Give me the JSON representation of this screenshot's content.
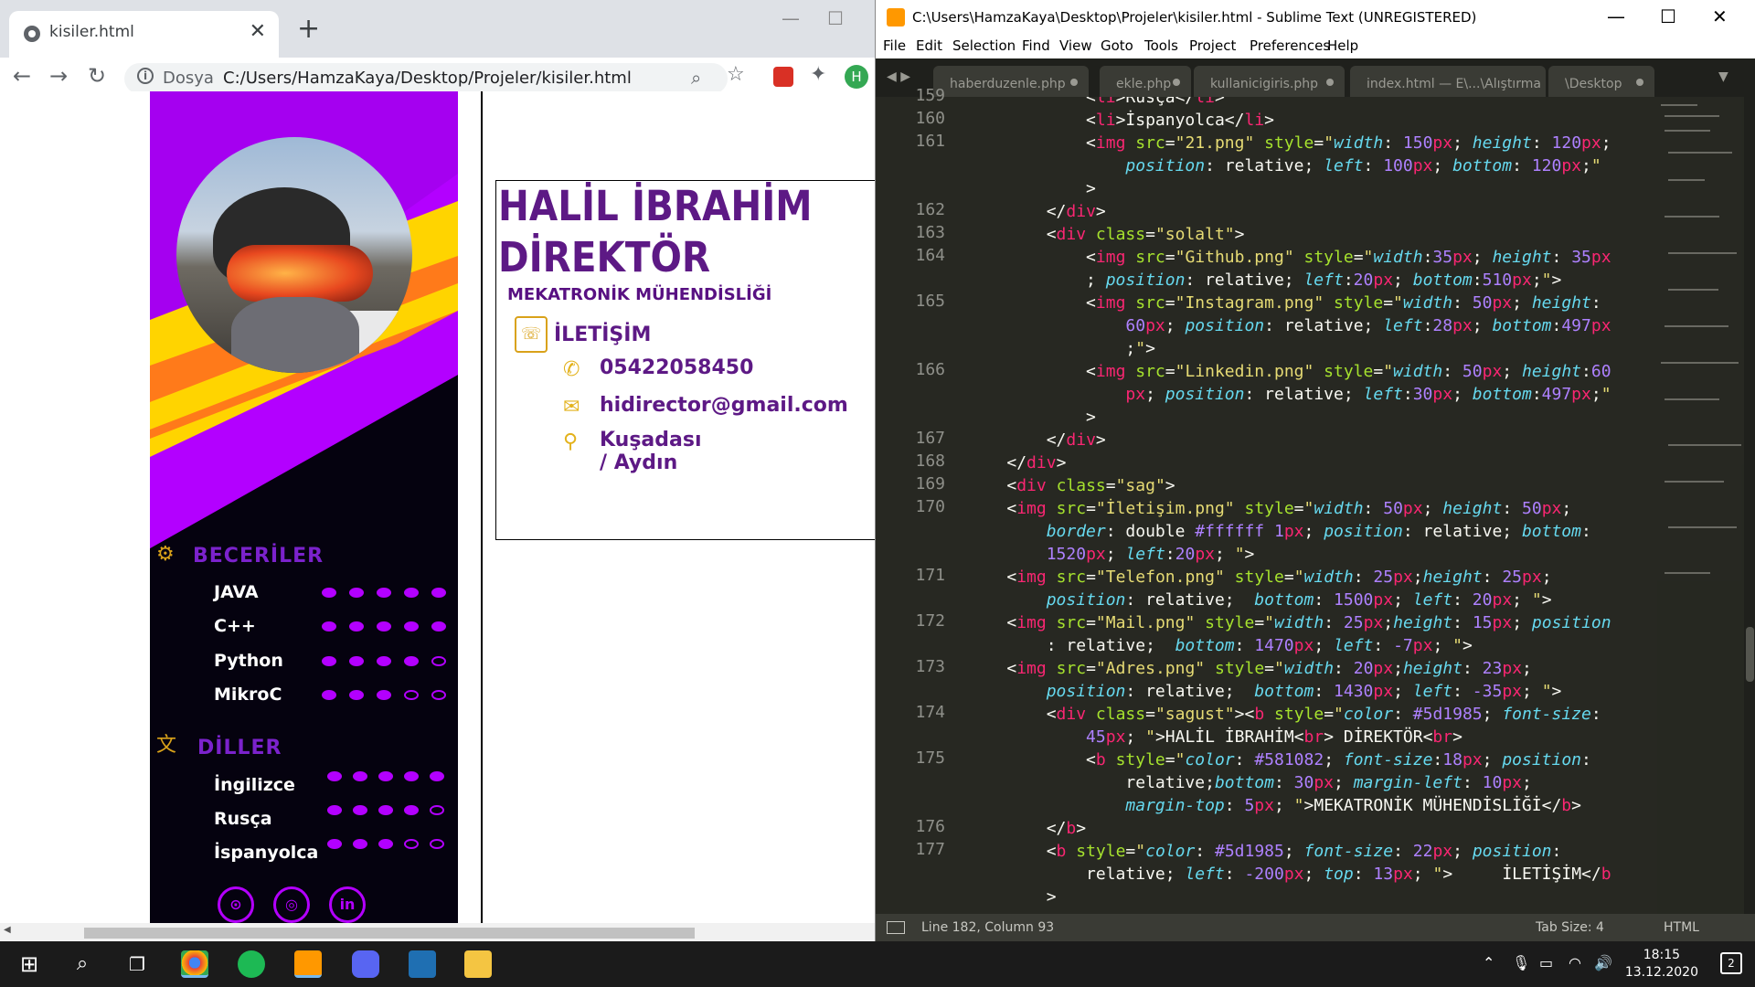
{
  "chrome": {
    "tab_title": "kisiler.html",
    "close_tab": "✕",
    "new_tab": "+",
    "scheme": "Dosya",
    "url": "C:/Users/HamzaKaya/Desktop/Projeler/kisiler.html",
    "profile_initial": "H",
    "minimize": "—",
    "maximize": "☐"
  },
  "cv": {
    "name_line1": "HALİL İBRAHİM",
    "name_line2": "DİREKTÖR",
    "title": "MEKATRONİK MÜHENDİSLİĞİ",
    "contact_title": "İLETİŞİM",
    "phone": "05422058450",
    "email": "hidirector@gmail.com",
    "address": "Kuşadası / Aydın",
    "skills_title": "BECERİLER",
    "skills": [
      {
        "name": "JAVA",
        "level": 5
      },
      {
        "name": "C++",
        "level": 5
      },
      {
        "name": "Python",
        "level": 4
      },
      {
        "name": "MikroC",
        "level": 3
      }
    ],
    "languages_title": "DİLLER",
    "languages": [
      {
        "name": "İngilizce",
        "level": 5
      },
      {
        "name": "Rusça",
        "level": 4
      },
      {
        "name": "İspanyolca",
        "level": 3
      }
    ],
    "social": [
      "github-icon",
      "instagram-icon",
      "linkedin-icon"
    ],
    "colors": {
      "purple": "#5d1985",
      "violet": "#b300ff",
      "yellow": "#ffd400"
    }
  },
  "sublime": {
    "window_title": "C:\\Users\\HamzaKaya\\Desktop\\Projeler\\kisiler.html - Sublime Text (UNREGISTERED)",
    "menu": [
      "File",
      "Edit",
      "Selection",
      "Find",
      "View",
      "Goto",
      "Tools",
      "Project",
      "Preferences",
      "Help"
    ],
    "tabs": [
      "haberduzenle.php",
      "ekle.php",
      "kullanicigiris.php",
      "index.html — E\\...\\Alıştırma",
      "\\Desktop"
    ],
    "line_numbers": [
      "159",
      "160",
      "161",
      "162",
      "163",
      "164",
      "165",
      "166",
      "167",
      "168",
      "169",
      "170",
      "171",
      "172",
      "173",
      "174",
      "175",
      "176",
      "177"
    ],
    "status_left": "Line 182, Column 93",
    "status_tab": "Tab Size: 4",
    "status_syntax": "HTML"
  },
  "taskbar": {
    "time": "18:15",
    "date": "13.12.2020",
    "notifications": "2"
  }
}
